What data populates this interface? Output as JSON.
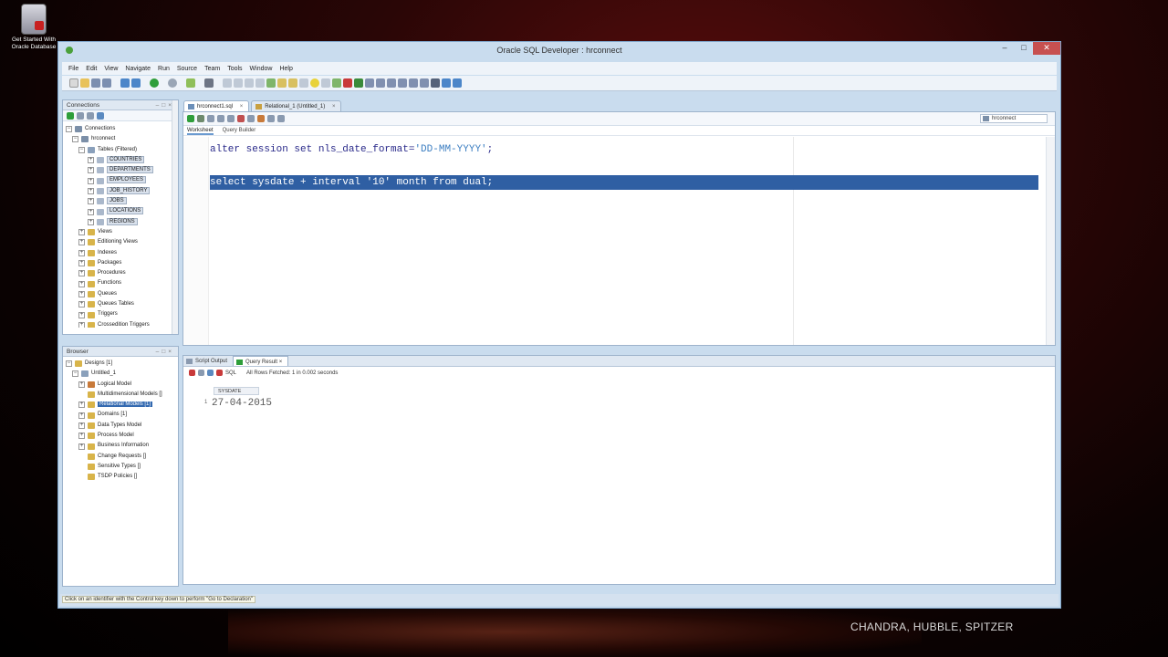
{
  "desktop": {
    "icon_label_line1": "Get Started With",
    "icon_label_line2": "Oracle Database",
    "credit": "CHANDRA, HUBBLE, SPITZER"
  },
  "window": {
    "title": "Oracle SQL Developer : hrconnect",
    "min": "–",
    "max": "□",
    "close": "✕"
  },
  "menu": [
    "File",
    "Edit",
    "View",
    "Navigate",
    "Run",
    "Source",
    "Team",
    "Tools",
    "Window",
    "Help"
  ],
  "connections_panel": {
    "title": "Connections",
    "root": "Connections",
    "connection": "hrconnect",
    "tables_node": "Tables (Filtered)",
    "tables": [
      "COUNTRIES",
      "DEPARTMENTS",
      "EMPLOYEES",
      "JOB_HISTORY",
      "JOBS",
      "LOCATIONS",
      "REGIONS"
    ],
    "nodes": [
      "Views",
      "Editioning Views",
      "Indexes",
      "Packages",
      "Procedures",
      "Functions",
      "Queues",
      "Queues Tables",
      "Triggers",
      "Crossedition Triggers"
    ]
  },
  "browser_panel": {
    "title": "Browser",
    "designs": "Designs [1]",
    "design": "Untitled_1",
    "items": [
      {
        "label": "Logical Model",
        "selected": false
      },
      {
        "label": "Multidimensional Models []",
        "selected": false
      },
      {
        "label": "Relational Models [1]",
        "selected": true
      },
      {
        "label": "Domains [1]",
        "selected": false
      },
      {
        "label": "Data Types Model",
        "selected": false
      },
      {
        "label": "Process Model",
        "selected": false
      },
      {
        "label": "Business Information",
        "selected": false
      },
      {
        "label": "Change Requests []",
        "selected": false
      },
      {
        "label": "Sensitive Types []",
        "selected": false
      },
      {
        "label": "TSDP Policies []",
        "selected": false
      }
    ]
  },
  "editor": {
    "tabs": [
      {
        "label": "hrconnect1.sql",
        "active": true
      },
      {
        "label": "Relational_1 (Untitled_1)",
        "active": false
      }
    ],
    "connection_select": "hrconnect",
    "subtabs": [
      "Worksheet",
      "Query Builder"
    ],
    "line1_a": "alter session set nls_date_format=",
    "line1_b": "'DD-MM-YYYY'",
    "line1_c": ";",
    "line2": "select sysdate + interval '10' month from dual;"
  },
  "results": {
    "tabs": [
      "Script Output",
      "Query Result"
    ],
    "sql_label": "SQL",
    "status": "All Rows Fetched: 1 in 0.002 seconds",
    "column": "SYSDATE",
    "row_num": "1",
    "value": "27-04-2015"
  },
  "statusbar": {
    "message": "Click on an identifier with the Control key down to perform \"Go to Declaration\""
  }
}
